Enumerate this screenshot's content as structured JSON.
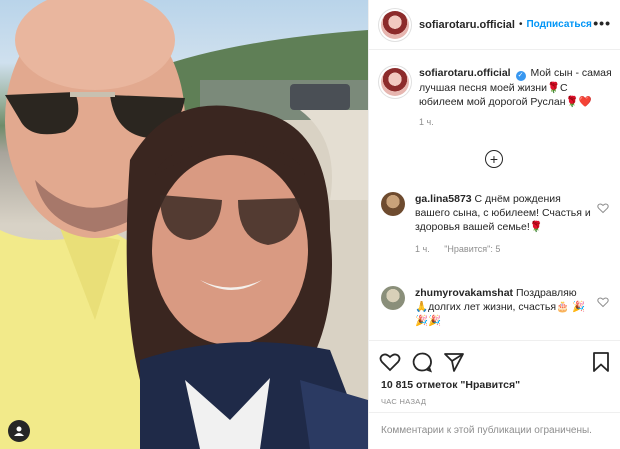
{
  "post": {
    "photo_alt": "selfie photo",
    "user_tag_icon": "person-icon"
  },
  "header": {
    "username": "sofiarotaru.official",
    "dot": "•",
    "follow_label": "Подписаться",
    "more_label": "•••"
  },
  "caption": {
    "username": "sofiarotaru.official",
    "text_part1": "Мой сын - самая лучшая песня моей жизни",
    "text_part2": "С юбилеем мой дорогой Руслан",
    "emoji1": "🌹",
    "emoji2": "🌹❤️",
    "time": "1 ч."
  },
  "comments": [
    {
      "username": "ga.lina5873",
      "text": "С днём рождения вашего сына, с юбилеем! Счастья и здоровья вашей семье!",
      "emoji": "🌹",
      "time": "1 ч.",
      "likes": "\"Нравится\": 5"
    },
    {
      "username": "zhumyrovakamshat",
      "text": "Поздравляю",
      "text2": "долгих лет жизни, счастья",
      "emoji_a": "🙏",
      "emoji_b": "🎂",
      "emoji_c": "🎉🎉🎉"
    }
  ],
  "actions": {
    "likes_text": "10 815 отметок \"Нравится\"",
    "time_ago": "ЧАС НАЗАД"
  },
  "footer": {
    "comments_disabled": "Комментарии к этой публикации ограничены."
  },
  "colors": {
    "accent": "#0095f6",
    "verified": "#3897f0",
    "muted": "#8e8e8e",
    "text": "#262626"
  }
}
